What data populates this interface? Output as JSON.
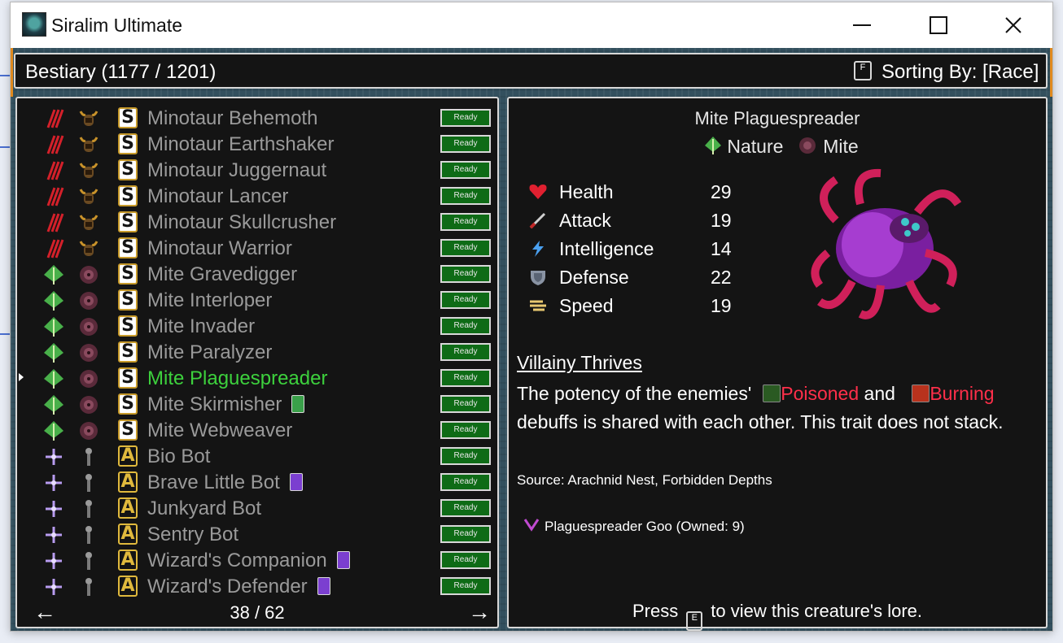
{
  "window": {
    "title": "Siralim Ultimate"
  },
  "header": {
    "title": "Bestiary (1177 / 1201)",
    "sort_key": "F",
    "sort_label": "Sorting By: [Race]"
  },
  "list": {
    "rows": [
      {
        "name": "Minotaur Behemoth",
        "race": "Minotaur",
        "race_icon": "claw-marks-icon",
        "rank": "S",
        "card": "",
        "status": "Ready",
        "selected": false
      },
      {
        "name": "Minotaur Earthshaker",
        "race": "Minotaur",
        "race_icon": "claw-marks-icon",
        "rank": "S",
        "card": "",
        "status": "Ready",
        "selected": false
      },
      {
        "name": "Minotaur Juggernaut",
        "race": "Minotaur",
        "race_icon": "claw-marks-icon",
        "rank": "S",
        "card": "",
        "status": "Ready",
        "selected": false
      },
      {
        "name": "Minotaur Lancer",
        "race": "Minotaur",
        "race_icon": "claw-marks-icon",
        "rank": "S",
        "card": "",
        "status": "Ready",
        "selected": false
      },
      {
        "name": "Minotaur Skullcrusher",
        "race": "Minotaur",
        "race_icon": "claw-marks-icon",
        "rank": "S",
        "card": "",
        "status": "Ready",
        "selected": false
      },
      {
        "name": "Minotaur Warrior",
        "race": "Minotaur",
        "race_icon": "claw-marks-icon",
        "rank": "S",
        "card": "",
        "status": "Ready",
        "selected": false
      },
      {
        "name": "Mite Gravedigger",
        "race": "Mite",
        "race_icon": "nature-leaf-icon",
        "rank": "S",
        "card": "",
        "status": "Ready",
        "selected": false
      },
      {
        "name": "Mite Interloper",
        "race": "Mite",
        "race_icon": "nature-leaf-icon",
        "rank": "S",
        "card": "",
        "status": "Ready",
        "selected": false
      },
      {
        "name": "Mite Invader",
        "race": "Mite",
        "race_icon": "nature-leaf-icon",
        "rank": "S",
        "card": "",
        "status": "Ready",
        "selected": false
      },
      {
        "name": "Mite Paralyzer",
        "race": "Mite",
        "race_icon": "nature-leaf-icon",
        "rank": "S",
        "card": "",
        "status": "Ready",
        "selected": false
      },
      {
        "name": "Mite Plaguespreader",
        "race": "Mite",
        "race_icon": "nature-leaf-icon",
        "rank": "S",
        "card": "",
        "status": "Ready",
        "selected": true
      },
      {
        "name": "Mite Skirmisher",
        "race": "Mite",
        "race_icon": "nature-leaf-icon",
        "rank": "S",
        "card": "green",
        "status": "Ready",
        "selected": false
      },
      {
        "name": "Mite Webweaver",
        "race": "Mite",
        "race_icon": "nature-leaf-icon",
        "rank": "S",
        "card": "",
        "status": "Ready",
        "selected": false
      },
      {
        "name": "Bio Bot",
        "race": "Bot",
        "race_icon": "arcane-sparkle-icon",
        "rank": "A",
        "card": "",
        "status": "Ready",
        "selected": false
      },
      {
        "name": "Brave Little Bot",
        "race": "Bot",
        "race_icon": "arcane-sparkle-icon",
        "rank": "A",
        "card": "purple",
        "status": "Ready",
        "selected": false
      },
      {
        "name": "Junkyard Bot",
        "race": "Bot",
        "race_icon": "arcane-sparkle-icon",
        "rank": "A",
        "card": "",
        "status": "Ready",
        "selected": false
      },
      {
        "name": "Sentry Bot",
        "race": "Bot",
        "race_icon": "arcane-sparkle-icon",
        "rank": "A",
        "card": "",
        "status": "Ready",
        "selected": false
      },
      {
        "name": "Wizard's Companion",
        "race": "Bot",
        "race_icon": "arcane-sparkle-icon",
        "rank": "A",
        "card": "purple",
        "status": "Ready",
        "selected": false
      },
      {
        "name": "Wizard's Defender",
        "race": "Bot",
        "race_icon": "arcane-sparkle-icon",
        "rank": "A",
        "card": "purple",
        "status": "Ready",
        "selected": false
      }
    ],
    "page_indicator": "38 / 62",
    "prev_arrow": "←",
    "next_arrow": "→"
  },
  "detail": {
    "name": "Mite Plaguespreader",
    "class_label": "Nature",
    "race_label": "Mite",
    "stats": [
      {
        "label": "Health",
        "value": "29",
        "icon": "heart-icon"
      },
      {
        "label": "Attack",
        "value": "19",
        "icon": "sword-icon"
      },
      {
        "label": "Intelligence",
        "value": "14",
        "icon": "lightning-icon"
      },
      {
        "label": "Defense",
        "value": "22",
        "icon": "shield-icon"
      },
      {
        "label": "Speed",
        "value": "19",
        "icon": "wing-icon"
      }
    ],
    "trait": {
      "name": "Villainy Thrives",
      "desc_part1": "The potency of the enemies'",
      "debuff1": "Poisoned",
      "desc_and": "and",
      "debuff2": "Burning",
      "desc_part2": "debuffs is shared with each other. This trait does not stack."
    },
    "source": "Source: Arachnid Nest, Forbidden Depths",
    "material": "Plaguespreader Goo (Owned: 9)",
    "lore": {
      "press": "Press",
      "key": "E",
      "rest": "to view this creature's lore."
    }
  },
  "colors": {
    "panel_bg": "#141414",
    "panel_border": "#d8d8d8",
    "selected_text": "#3dd13d",
    "unselected_text": "#9a9a9a",
    "ready_bg": "#0e6b16",
    "debuff_red": "#ff2f4a"
  }
}
